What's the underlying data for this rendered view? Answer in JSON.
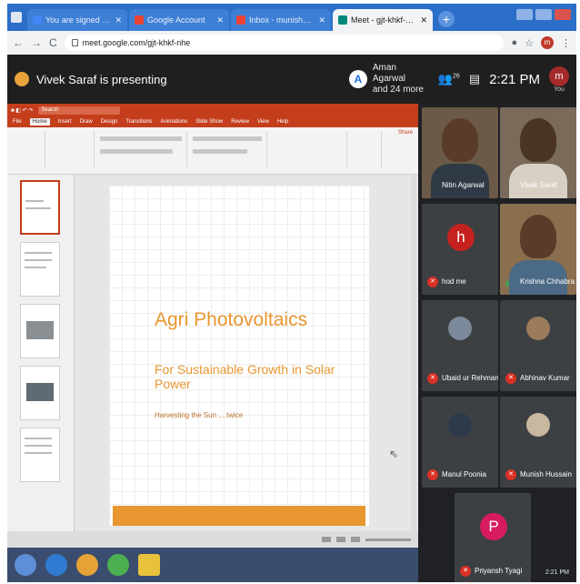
{
  "browser": {
    "tabs": [
      {
        "label": "You are signed in as ganesh675...",
        "icon_color": "#4285f4",
        "active": false
      },
      {
        "label": "Google Account",
        "icon_color": "#ea4335",
        "active": false
      },
      {
        "label": "Inbox - munish@mbs...tabad",
        "icon_color": "#ea4335",
        "active": false
      },
      {
        "label": "Meet - gjt-khkf-nhe",
        "icon_color": "#00897b",
        "active": true
      }
    ],
    "new_tab_label": "+",
    "address": "meet.google.com/gjt-khkf-nhe",
    "back_label": "←",
    "forward_label": "→",
    "reload_label": "C"
  },
  "meet": {
    "presenting_text": "Vivek Saraf is presenting",
    "guest_name": "Aman Agarwal",
    "guest_more": "and 24 more",
    "guest_initial": "A",
    "people_count": "26",
    "time": "2:21 PM",
    "you_initial": "m",
    "you_label": "You"
  },
  "ppt": {
    "ribbon_tabs": [
      "File",
      "Home",
      "Insert",
      "Draw",
      "Design",
      "Transitions",
      "Animations",
      "Slide Show",
      "Review",
      "View",
      "Help"
    ],
    "search_placeholder": "Search",
    "share_label": "Share",
    "slide": {
      "title": "Agri Photovoltaics",
      "subtitle": "For Sustainable Growth in Solar Power",
      "tagline": "Harvesting the Sun ....twice"
    }
  },
  "participants": [
    {
      "name": "Nitin Agarwal",
      "type": "video"
    },
    {
      "name": "Vivek Saraf",
      "type": "video"
    },
    {
      "name": "hod me",
      "type": "letter",
      "letter": "h",
      "color": "#c5221f"
    },
    {
      "name": "Krishna Chhabra",
      "type": "video"
    },
    {
      "name": "Ubaid ur Rehman",
      "type": "photo"
    },
    {
      "name": "Abhinav Kumar",
      "type": "photo"
    },
    {
      "name": "Manul Poonia",
      "type": "photo"
    },
    {
      "name": "Munish Hussain",
      "type": "photo"
    },
    {
      "name": "Priyansh Tyagi",
      "type": "letter",
      "letter": "P",
      "color": "#d81b60"
    }
  ],
  "taskbar": {
    "clock": "2:21 PM"
  },
  "colors": {
    "accent": "#e8962f",
    "ppt_red": "#c43e1c",
    "mic_off": "#d93025"
  }
}
